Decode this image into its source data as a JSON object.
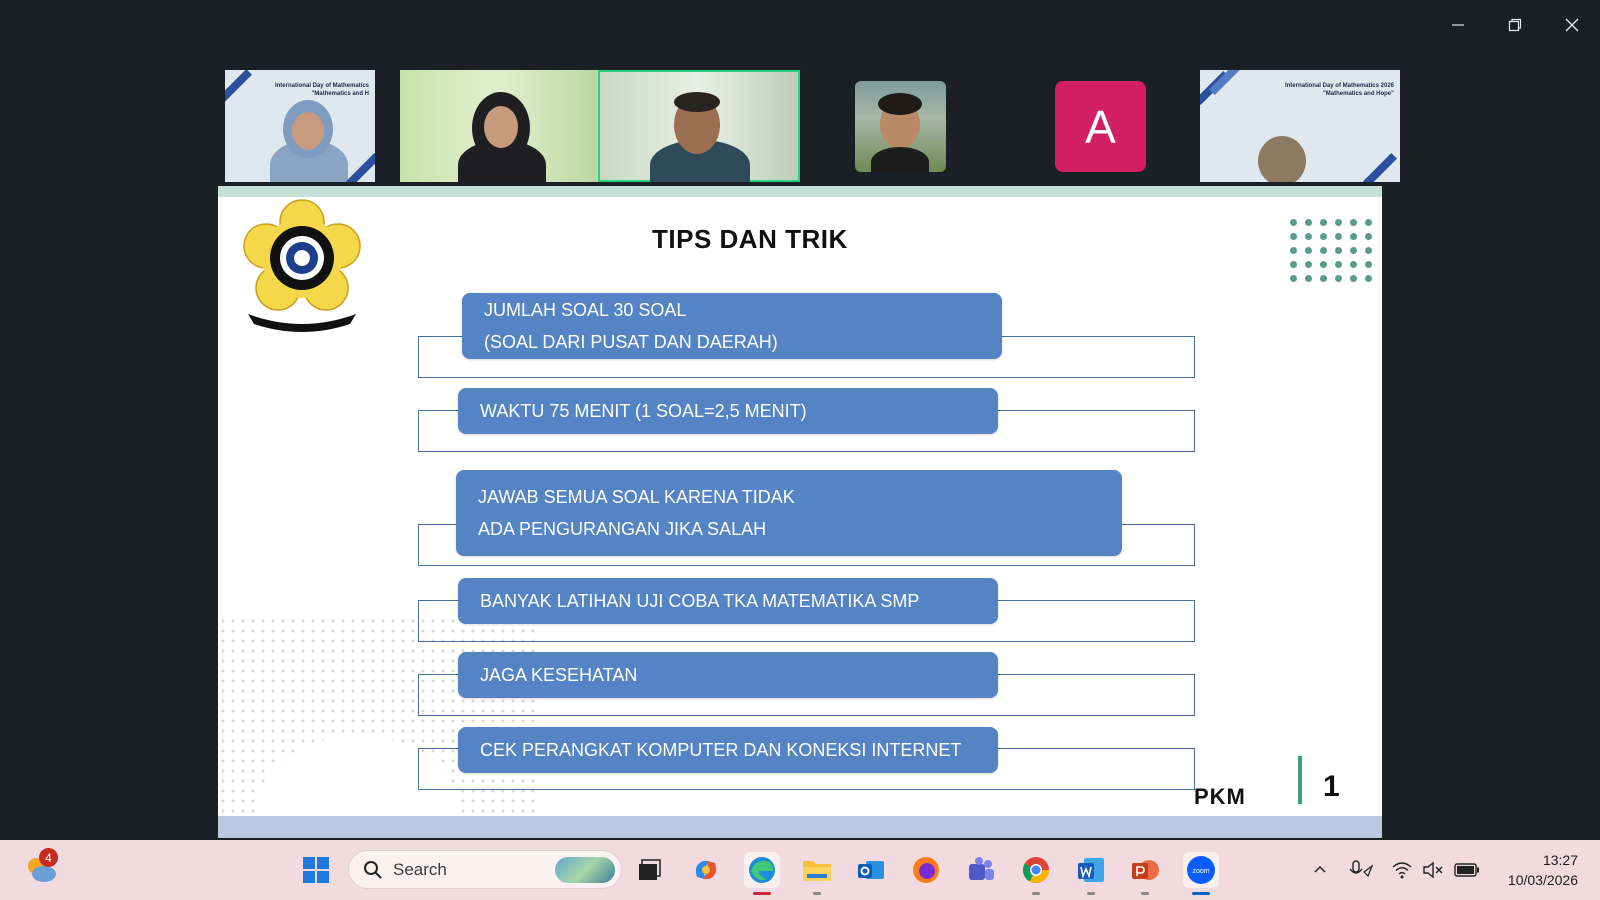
{
  "window": {
    "controls": [
      "minimize",
      "restore",
      "close"
    ]
  },
  "participants": [
    {
      "id": "p1",
      "type": "video",
      "thumb_title": "International Day of Mathematics\n\"Mathematics and H"
    },
    {
      "id": "p2",
      "type": "video"
    },
    {
      "id": "p3",
      "type": "video",
      "active_speaker": true
    },
    {
      "id": "p4",
      "type": "photo"
    },
    {
      "id": "p5",
      "type": "avatar",
      "initial": "A",
      "color": "#d21e63"
    },
    {
      "id": "p6",
      "type": "video",
      "thumb_title": "International Day of Mathematics 2026\n\"Mathematics and Hope\""
    }
  ],
  "slide": {
    "title": "TIPS DAN TRIK",
    "logo_text": "UNIVERSITAS SRIWIJAYA",
    "logo_motto": "ILMU ALAT PENGABDIAN",
    "items": [
      {
        "line1": "JUMLAH SOAL 30 SOAL",
        "line2": "(SOAL DARI PUSAT DAN DAERAH)"
      },
      {
        "line1": "WAKTU 75 MENIT (1 SOAL=2,5 MENIT)",
        "line2": ""
      },
      {
        "line1": "JAWAB SEMUA SOAL KARENA TIDAK",
        "line2": "ADA PENGURANGAN JIKA SALAH"
      },
      {
        "line1": "BANYAK LATIHAN UJI COBA TKA MATEMATIKA SMP",
        "line2": ""
      },
      {
        "line1": "JAGA KESEHATAN",
        "line2": ""
      },
      {
        "line1": "CEK PERANGKAT KOMPUTER DAN KONEKSI INTERNET",
        "line2": ""
      }
    ],
    "footer_label": "PKM",
    "page_number": "1",
    "accent_color": "#5484c4"
  },
  "taskbar": {
    "notification_count": "4",
    "search_placeholder": "Search",
    "apps": [
      "windows-start",
      "task-view",
      "copilot",
      "edge",
      "file-explorer",
      "outlook",
      "firefox",
      "teams",
      "chrome",
      "word",
      "powerpoint",
      "zoom"
    ],
    "time": "13:27",
    "date": "10/03/2026"
  }
}
